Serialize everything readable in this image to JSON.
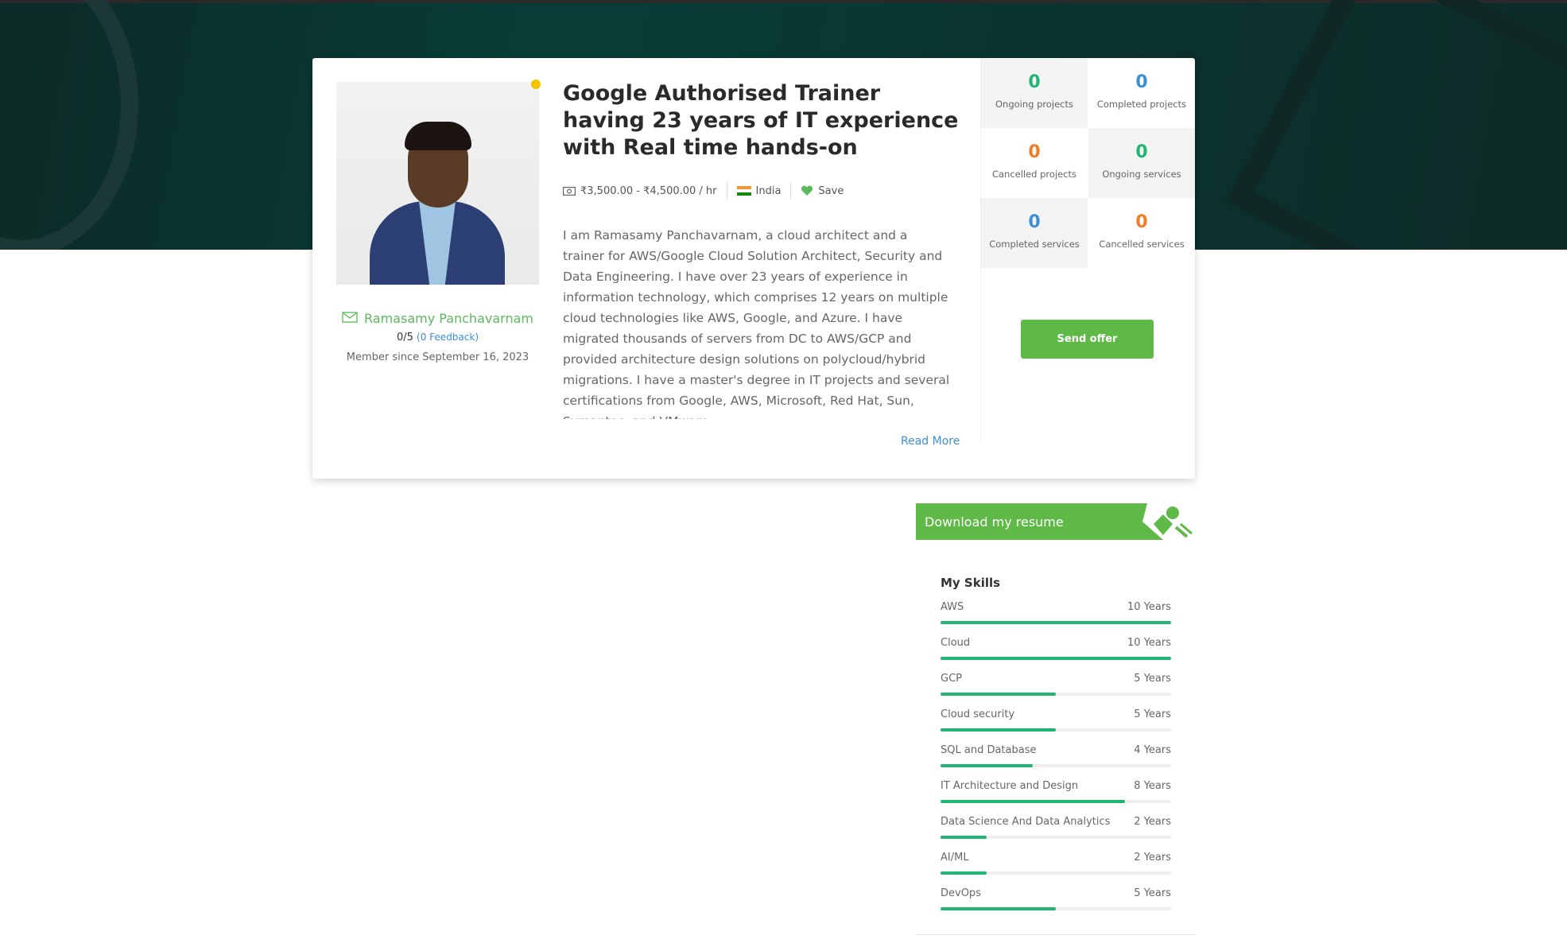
{
  "profile": {
    "name": "Ramasamy Panchavarnam",
    "rating": "0/5",
    "feedback": "(0 Feedback)",
    "member_since": "Member since September 16, 2023",
    "title": "Google Authorised Trainer having 23 years of IT experience with Real time hands-on",
    "rate": "₹3,500.00 - ₹4,500.00 / hr",
    "country": "India",
    "save_label": "Save",
    "description": "I am Ramasamy Panchavarnam, a cloud architect and a trainer for AWS/Google Cloud Solution Architect, Security and Data Engineering. I have over 23 years of experience in information technology, which comprises 12 years on multiple cloud technologies like AWS, Google, and Azure. I have migrated thousands of servers from DC to AWS/GCP and provided architecture design solutions on polycloud/hybrid migrations. I have a master's degree in IT projects and several certifications from Google, AWS, Microsoft, Red Hat, Sun, Symantec, and VMware.",
    "read_more": "Read More"
  },
  "stats": [
    {
      "value": "0",
      "label": "Ongoing projects",
      "color": "#21b573"
    },
    {
      "value": "0",
      "label": "Completed projects",
      "color": "#3a8fd6"
    },
    {
      "value": "0",
      "label": "Cancelled projects",
      "color": "#f07d26"
    },
    {
      "value": "0",
      "label": "Ongoing services",
      "color": "#21b573"
    },
    {
      "value": "0",
      "label": "Completed services",
      "color": "#3a8fd6"
    },
    {
      "value": "0",
      "label": "Cancelled services",
      "color": "#f07d26"
    }
  ],
  "send_offer": "Send offer",
  "resume": {
    "label": "Download my resume"
  },
  "skills": {
    "title": "My Skills",
    "items": [
      {
        "name": "AWS",
        "years": "10 Years",
        "level": 1.0
      },
      {
        "name": "Cloud",
        "years": "10 Years",
        "level": 1.0
      },
      {
        "name": "GCP",
        "years": "5 Years",
        "level": 0.5
      },
      {
        "name": "Cloud security",
        "years": "5 Years",
        "level": 0.5
      },
      {
        "name": "SQL and Database",
        "years": "4 Years",
        "level": 0.4
      },
      {
        "name": "IT Architecture and Design",
        "years": "8 Years",
        "level": 0.8
      },
      {
        "name": "Data Science And Data Analytics",
        "years": "2 Years",
        "level": 0.2
      },
      {
        "name": "AI/ML",
        "years": "2 Years",
        "level": 0.2
      },
      {
        "name": "DevOps",
        "years": "5 Years",
        "level": 0.5
      }
    ]
  },
  "colors": {
    "accent": "#5fb947",
    "link": "#3a8fd6",
    "bar": "#21b573",
    "online": "#f5c400"
  }
}
